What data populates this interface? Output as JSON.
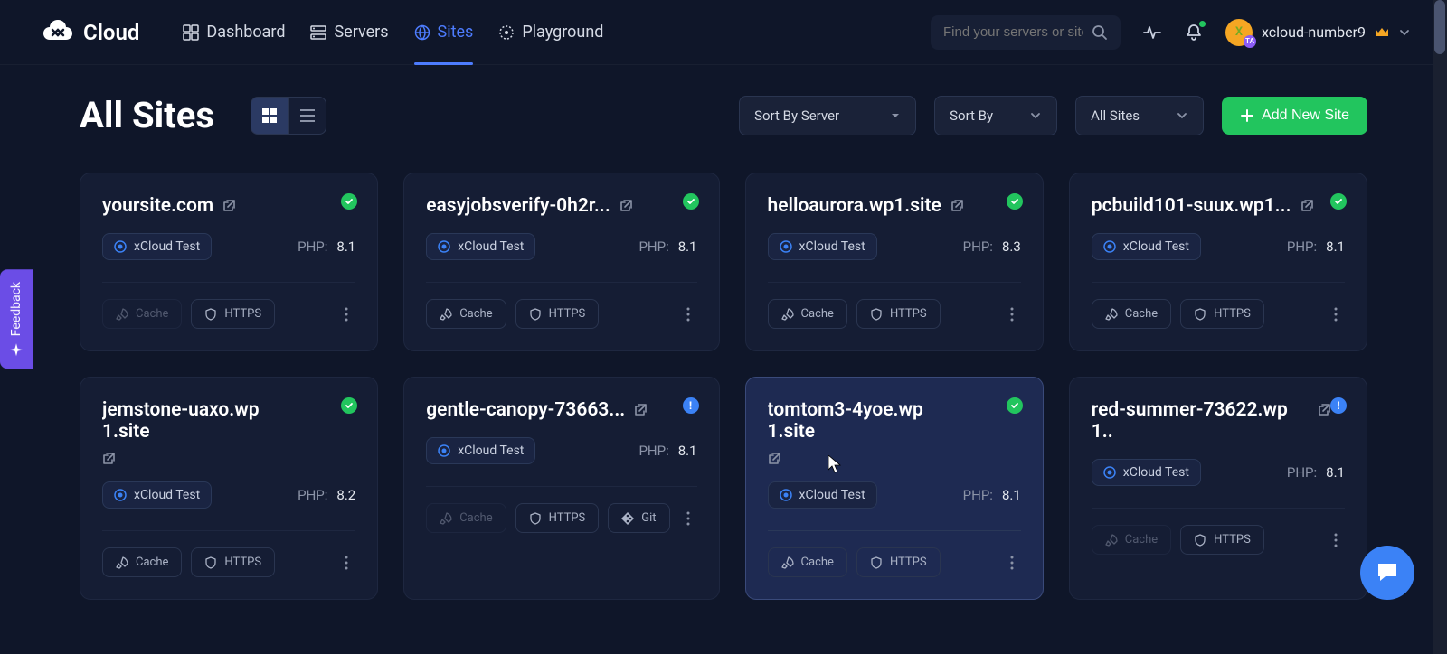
{
  "brand": "Cloud",
  "nav": {
    "dashboard": "Dashboard",
    "servers": "Servers",
    "sites": "Sites",
    "playground": "Playground"
  },
  "search": {
    "placeholder": "Find your servers or sites"
  },
  "user": {
    "initial": "X",
    "name": "xcloud-number9"
  },
  "page": {
    "title": "All Sites",
    "sortByServer": "Sort By Server",
    "sortBy": "Sort By",
    "filter": "All Sites",
    "addBtn": "Add New Site"
  },
  "labels": {
    "php": "PHP:",
    "cache": "Cache",
    "https": "HTTPS",
    "git": "Git",
    "feedback": "Feedback"
  },
  "sites": [
    {
      "name": "yoursite.com",
      "server": "xCloud Test",
      "php": "8.1",
      "status": "ok",
      "cacheFaded": true,
      "git": false
    },
    {
      "name": "easyjobsverify-0h2r...",
      "server": "xCloud Test",
      "php": "8.1",
      "status": "ok",
      "cacheFaded": false,
      "git": false
    },
    {
      "name": "helloaurora.wp1.site",
      "server": "xCloud Test",
      "php": "8.3",
      "status": "ok",
      "cacheFaded": false,
      "git": false
    },
    {
      "name": "pcbuild101-suux.wp1...",
      "server": "xCloud Test",
      "php": "8.1",
      "status": "ok",
      "cacheFaded": false,
      "git": false
    },
    {
      "name": "jemstone-uaxo.wp1.site",
      "server": "xCloud Test",
      "php": "8.2",
      "status": "ok",
      "cacheFaded": false,
      "git": false,
      "wrap": true
    },
    {
      "name": "gentle-canopy-73663...",
      "server": "xCloud Test",
      "php": "8.1",
      "status": "warn",
      "cacheFaded": true,
      "git": true
    },
    {
      "name": "tomtom3-4yoe.wp1.site",
      "server": "xCloud Test",
      "php": "8.1",
      "status": "ok",
      "cacheFaded": false,
      "git": false,
      "hover": true,
      "wrap": true
    },
    {
      "name": "red-summer-73622.wp1..",
      "server": "xCloud Test",
      "php": "8.1",
      "status": "warn",
      "cacheFaded": true,
      "git": false
    }
  ]
}
